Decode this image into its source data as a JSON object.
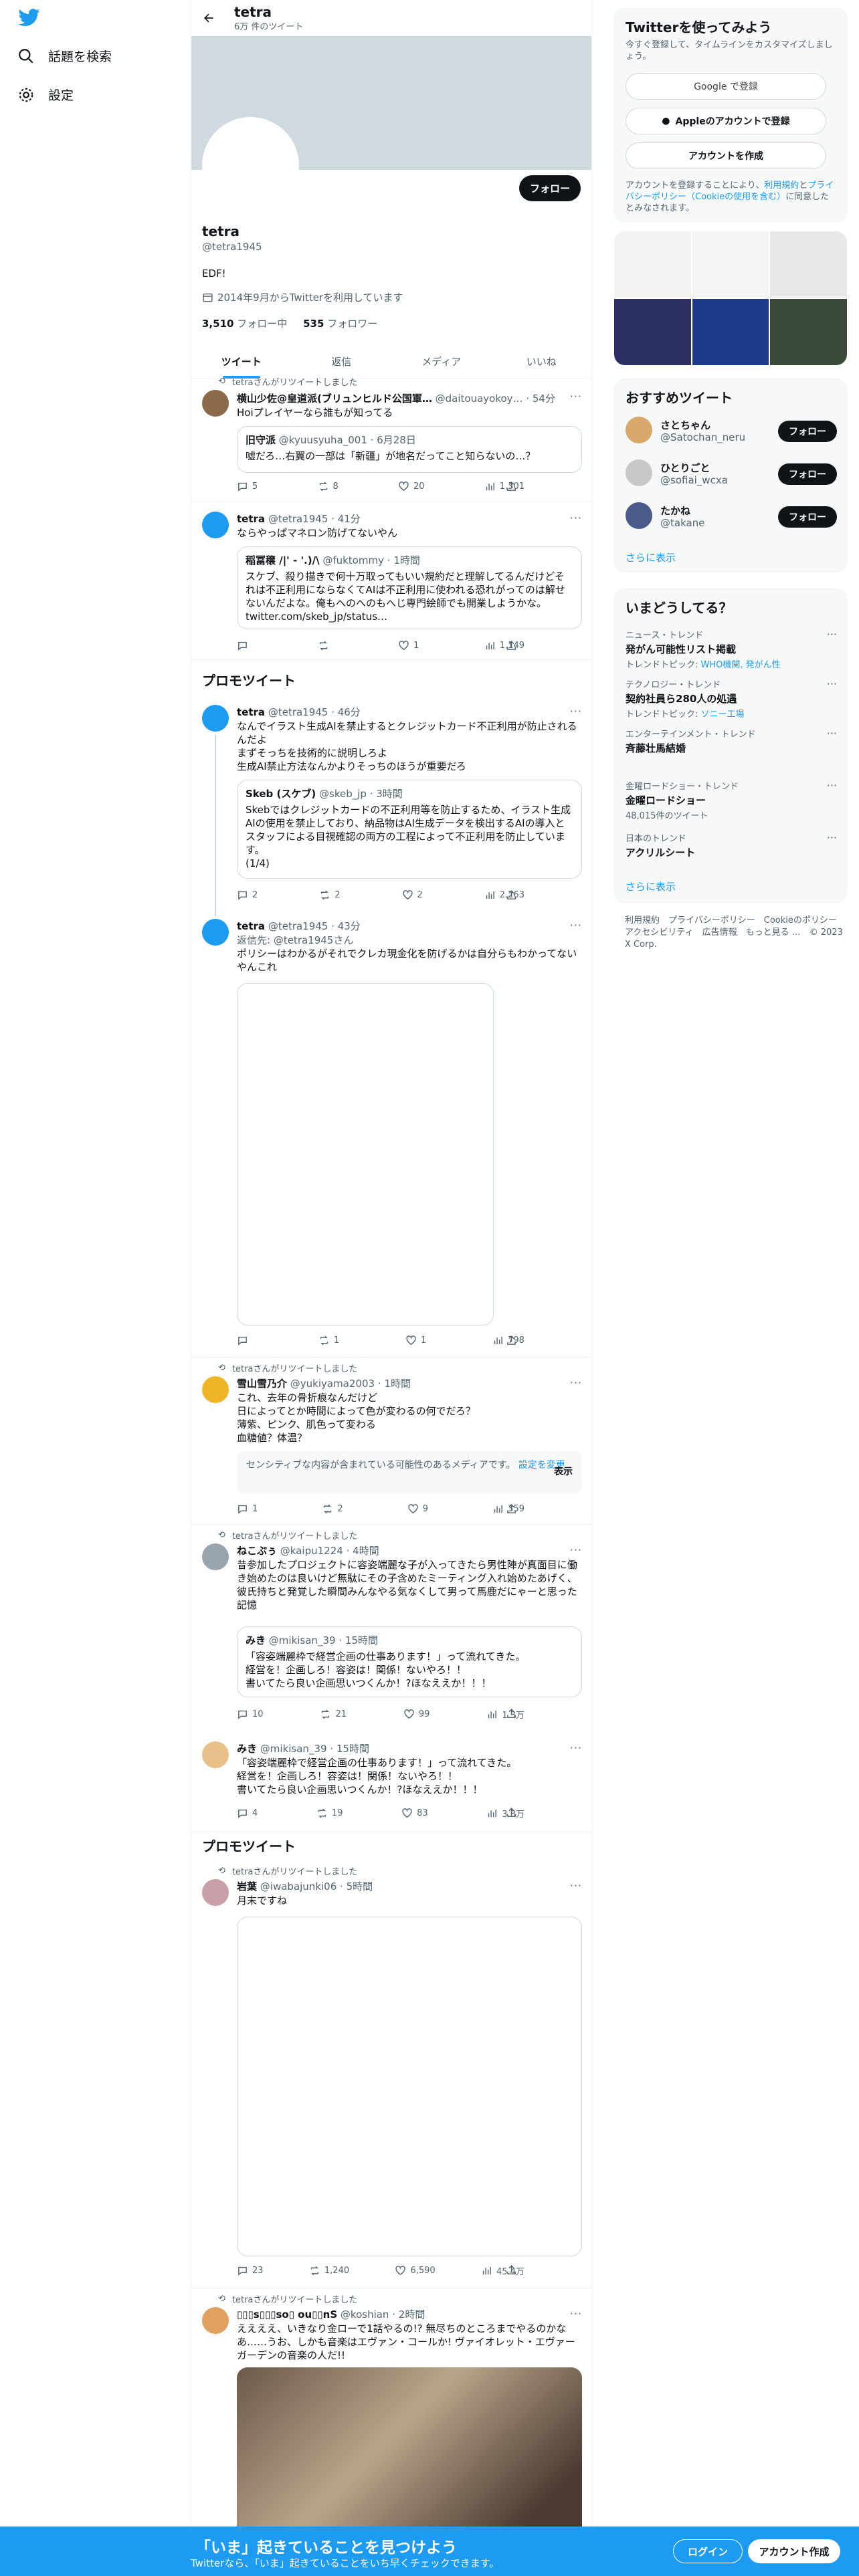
{
  "nav": {
    "explore": "話題を検索",
    "settings": "設定"
  },
  "header": {
    "name": "tetra",
    "tweet_count": "6万 件のツイート"
  },
  "profile": {
    "follow_label": "フォロー",
    "name": "tetra",
    "handle": "@tetra1945",
    "bio": "EDF!",
    "joined": "2014年9月からTwitterを利用しています",
    "following_count": "3,510",
    "following_label": "フォロー中",
    "followers_count": "535",
    "followers_label": "フォロワー"
  },
  "tabs": [
    "ツイート",
    "返信",
    "メディア",
    "いいね"
  ],
  "promo_label": "プロモツイート",
  "tweets": [
    {
      "retweet": "tetraさんがリツイートしました",
      "name": "横山少佐@皇道派(ブリュンヒルド公国軍…",
      "handle": "@daitouayokoy…",
      "time": "54分",
      "body": "Hoiプレイヤーなら誰もが知ってる",
      "quote": {
        "name": "旧守派",
        "handle": "@kyuusyuha_001",
        "time": "6月28日",
        "body": "嘘だろ…右翼の一部は「新疆」が地名だってこと知らないの…？"
      },
      "replies": "5",
      "retweets": "8",
      "likes": "20",
      "views": "1,301"
    },
    {
      "name": "tetra",
      "handle": "@tetra1945",
      "time": "41分",
      "body": "ならやっぱマネロン防げてないやん",
      "quote": {
        "name": "稲冨穣 /|' - '.)/\\",
        "handle": "@fuktommy",
        "time": "1時間",
        "body": "スケブ、殺り描きで何十万取ってもいい規約だと理解してるんだけどそれは不正利用にならなくてAIは不正利用に使われる恐れがってのは解せないんだよな。俺もへのへのもへじ専門絵師でも開業しようかな。\ntwitter.com/skeb_jp/status…"
      },
      "replies": "",
      "retweets": "",
      "likes": "1",
      "views": "1,149"
    },
    {
      "name": "tetra",
      "handle": "@tetra1945",
      "time": "46分",
      "body": "なんでイラスト生成AIを禁止するとクレジットカード不正利用が防止されるんだよ\nまずそっちを技術的に説明しろよ\n生成AI禁止方法なんかよりそっちのほうが重要だろ",
      "quote": {
        "name": "Skeb (スケブ)",
        "handle": "@skeb_jp",
        "time": "3時間",
        "body": "Skebではクレジットカードの不正利用等を防止するため、イラスト生成AIの使用を禁止しており、納品物はAI生成データを検出するAIの導入とスタッフによる目視確認の両方の工程によって不正利用を防止しています。\n(1/4)"
      },
      "replies": "2",
      "retweets": "2",
      "likes": "2",
      "views": "2,263"
    },
    {
      "name": "tetra",
      "handle": "@tetra1945",
      "time": "43分",
      "reply_to": "返信先: @tetra1945さん",
      "body": "ポリシーはわかるがそれでクレカ現金化を防げるかは自分らもわかってないやんこれ",
      "replies": "",
      "retweets": "1",
      "likes": "1",
      "views": "798"
    },
    {
      "retweet": "tetraさんがリツイートしました",
      "name": "雪山雪乃介",
      "handle": "@yukiyama2003",
      "time": "1時間",
      "body": "これ、去年の骨折痕なんだけど\n日によってとか時間によって色が変わるの何でだろ？\n薄紫、ピンク、肌色って変わる\n血糖値？体温？",
      "sensitive": "センシティブな内容が含まれている可能性のあるメディアです。",
      "sensitive_link": "設定を変更",
      "sensitive_btn": "表示",
      "replies": "1",
      "retweets": "2",
      "likes": "9",
      "views": "359"
    },
    {
      "retweet": "tetraさんがリツイートしました",
      "name": "ねこぷぅ",
      "handle": "@kaipu1224",
      "time": "4時間",
      "body": "昔参加したプロジェクトに容姿端麗な子が入ってきたら男性陣が真面目に働き始めたのは良いけど無駄にその子含めたミーティング入れ始めたあげく、彼氏持ちと発覚した瞬間みんなやる気なくして男って馬鹿だにゃーと思った記憶",
      "quote": {
        "name": "みき",
        "handle": "@mikisan_39",
        "time": "15時間",
        "body": "「容姿端麗枠で経営企画の仕事あります！」って流れてきた。\n経営を！企画しろ！容姿は！関係！ないやろ！！\n書いてたら良い企画思いつくんか！?ほなええか！！！"
      },
      "replies": "10",
      "retweets": "21",
      "likes": "99",
      "views": "1.3万"
    },
    {
      "name": "みき",
      "handle": "@mikisan_39",
      "time": "15時間",
      "body": "「容姿端麗枠で経営企画の仕事あります！」って流れてきた。\n経営を！企画しろ！容姿は！関係！ないやろ！！\n書いてたら良い企画思いつくんか！?ほなええか！！！",
      "replies": "4",
      "retweets": "19",
      "likes": "83",
      "views": "3.8万"
    },
    {
      "retweet": "tetraさんがリツイートしました",
      "name": "岩葉",
      "handle": "@iwabajunki06",
      "time": "5時間",
      "body": "月末ですね",
      "replies": "23",
      "retweets": "1,240",
      "likes": "6,590",
      "views": "45.4万"
    },
    {
      "retweet": "tetraさんがリツイートしました",
      "name": "▯▯▯s▯▯▯so▯ ou▯▯nS",
      "handle": "@koshian",
      "time": "2時間",
      "body": "ええええ、いきなり金ローで1話やるの!? 無尽ちのところまでやるのかなあ……うお、しかも音楽はエヴァン・コールか! ヴァイオレット・エヴァーガーデンの音楽の人だ!!"
    }
  ],
  "right": {
    "signup_title": "Twitterを使ってみよう",
    "signup_sub": "今すぐ登録して、タイムラインをカスタマイズしましょう。",
    "google_btn": "Google で登録",
    "apple_btn": "Appleのアカウントで登録",
    "create_btn": "アカウントを作成",
    "terms_1": "アカウントを登録することにより、",
    "terms_link1": "利用規約",
    "terms_2": "と",
    "terms_link2": "プライバシーポリシー（Cookieの使用を含む）",
    "terms_3": "に同意したとみなされます。",
    "rec_title": "おすすめツイート",
    "rec": [
      {
        "name": "さとちゃん",
        "handle": "@Satochan_neru",
        "btn": "フォロー"
      },
      {
        "name": "ひとりごと",
        "handle": "@sofiai_wcxa",
        "btn": "フォロー"
      },
      {
        "name": "たかね",
        "handle": "@takane",
        "btn": "フォロー"
      }
    ],
    "more": "さらに表示",
    "trends_title": "いまどうしてる？",
    "trends": [
      {
        "cat": "ニュース・トレンド",
        "name": "発がん可能性リスト掲載",
        "extra": "トレンドトピック: ",
        "links": "WHO機関, 発がん性"
      },
      {
        "cat": "テクノロジー・トレンド",
        "name": "契約社員ら280人の処遇",
        "extra": "トレンドトピック: ",
        "links": "ソニー工場"
      },
      {
        "cat": "エンターテインメント・トレンド",
        "name": "斉藤壮馬結婚",
        "extra": "",
        "links": ""
      },
      {
        "cat": "金曜ロードショー・トレンド",
        "name": "金曜ロードショー",
        "extra": "48,015件のツイート",
        "links": ""
      },
      {
        "cat": "日本のトレンド",
        "name": "アクリルシート",
        "extra": "",
        "links": ""
      }
    ],
    "footer": "利用規約　プライバシーポリシー　Cookieのポリシー　アクセシビリティ　広告情報　もっと見る …　© 2023 X Corp."
  },
  "bottom": {
    "title": "「いま」起きていることを見つけよう",
    "sub": "Twitterなら、「いま」起きていることをいち早くチェックできます。",
    "login": "ログイン",
    "signup": "アカウント作成"
  },
  "colors": {
    "accent": "#1d9bf0",
    "text": "#0f1419",
    "muted": "#536471",
    "border": "#eff3f4"
  }
}
